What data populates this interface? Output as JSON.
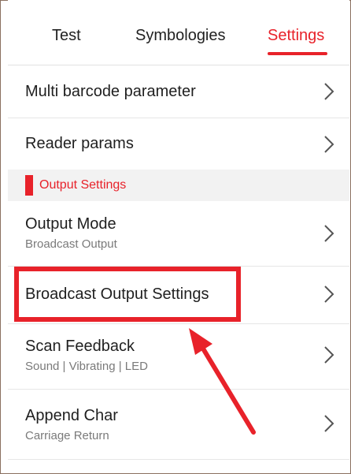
{
  "tabs": [
    {
      "label": "Test"
    },
    {
      "label": "Symbologies"
    },
    {
      "label": "Settings"
    }
  ],
  "active_tab": "Settings",
  "rows": {
    "multi_barcode": {
      "title": "Multi barcode parameter"
    },
    "reader_params": {
      "title": "Reader params"
    },
    "output_mode": {
      "title": "Output Mode",
      "sub": "Broadcast Output"
    },
    "broadcast_settings": {
      "title": "Broadcast Output Settings"
    },
    "scan_feedback": {
      "title": "Scan Feedback",
      "sub": "Sound | Vibrating | LED"
    },
    "append_char": {
      "title": "Append Char",
      "sub": "Carriage Return"
    }
  },
  "section": {
    "label": "Output Settings"
  },
  "colors": {
    "accent": "#e8222a",
    "annotation": "#e8222a"
  },
  "icons": {
    "row_chevron": "chevron-right-icon"
  }
}
